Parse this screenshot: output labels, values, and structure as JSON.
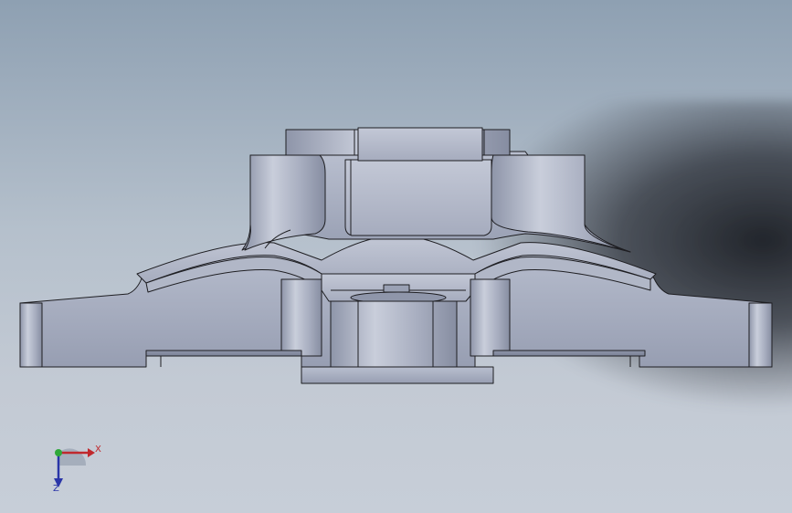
{
  "viewport": {
    "background_top": "#8ea0b2",
    "background_bottom": "#c7ced8",
    "part_color": "#a3aabd",
    "edge_color": "#1e1e22"
  },
  "triad": {
    "x_label": "X",
    "z_label": "Z",
    "x_color": "#c0282d",
    "y_color": "#2fa83a",
    "z_color": "#2a35a8"
  }
}
